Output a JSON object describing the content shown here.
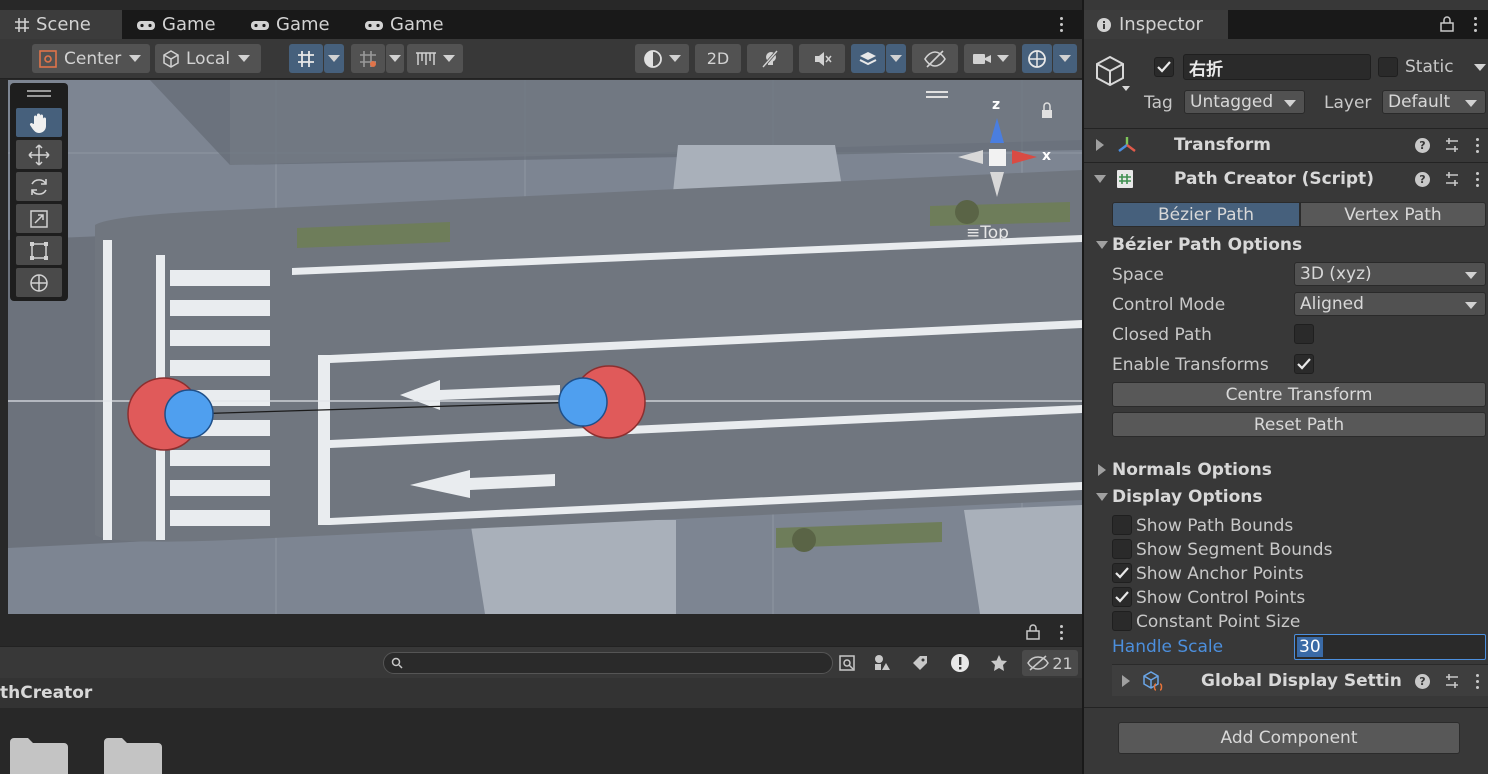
{
  "scene_tabs": [
    {
      "label": "Scene",
      "icon": "grid-icon"
    },
    {
      "label": "Game",
      "icon": "gamepad-icon"
    },
    {
      "label": "Game",
      "icon": "gamepad-icon"
    },
    {
      "label": "Game",
      "icon": "gamepad-icon"
    }
  ],
  "toolbar": {
    "pivot_mode": "Center",
    "pivot_rotation": "Local",
    "view_2d": "2D"
  },
  "gizmo": {
    "axis_z": "z",
    "axis_x": "x",
    "view_label": "Top"
  },
  "project": {
    "path_label": "thCreator",
    "search_placeholder": "",
    "hidden_count": "21"
  },
  "inspector": {
    "tab_title": "Inspector",
    "object_name": "右折",
    "object_active": true,
    "static_label": "Static",
    "tag_label": "Tag",
    "tag_value": "Untagged",
    "layer_label": "Layer",
    "layer_value": "Default",
    "components": {
      "transform": "Transform",
      "path_creator": "Path Creator (Script)"
    },
    "path_tabs": [
      "Bézier Path",
      "Vertex Path"
    ],
    "bezier_options": {
      "header": "Bézier Path Options",
      "space_label": "Space",
      "space_value": "3D (xyz)",
      "control_mode_label": "Control Mode",
      "control_mode_value": "Aligned",
      "closed_path_label": "Closed Path",
      "closed_path": false,
      "enable_transforms_label": "Enable Transforms",
      "enable_transforms": true,
      "centre_transform": "Centre Transform",
      "reset_path": "Reset Path"
    },
    "normals_options": "Normals Options",
    "display_options": {
      "header": "Display Options",
      "items": [
        {
          "label": "Show Path Bounds",
          "checked": false
        },
        {
          "label": "Show Segment Bounds",
          "checked": false
        },
        {
          "label": "Show Anchor Points",
          "checked": true
        },
        {
          "label": "Show Control Points",
          "checked": true
        },
        {
          "label": "Constant Point Size",
          "checked": false
        }
      ],
      "handle_scale_label": "Handle Scale",
      "handle_scale_value": "30",
      "global_display": "Global Display Settin"
    },
    "add_component": "Add Component"
  },
  "colors": {
    "accent_blue": "#46607c",
    "selection_text": "#4c8fdd",
    "anchor_red": "#e05a5a",
    "control_blue": "#4f9fef"
  }
}
